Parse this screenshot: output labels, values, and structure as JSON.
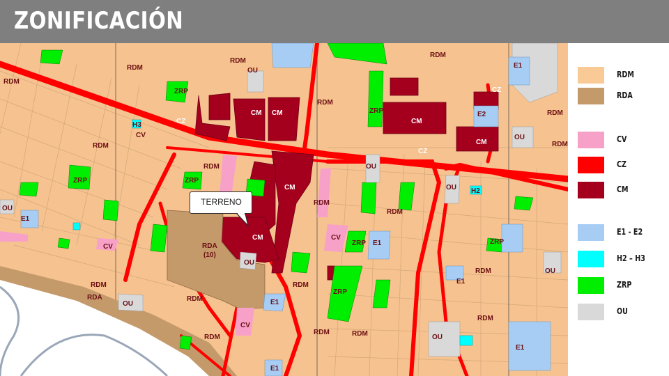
{
  "title": "ZONIFICACIÓN",
  "callout": {
    "label": "TERRENO"
  },
  "legend": [
    {
      "code": "RDM",
      "color": "#f9c996"
    },
    {
      "code": "RDA",
      "color": "#c59a6b"
    },
    {
      "code": "CV",
      "color": "#f7a1c9"
    },
    {
      "code": "CZ",
      "color": "#fe0000"
    },
    {
      "code": "CM",
      "color": "#a4001e"
    },
    {
      "code": "E1 - E2",
      "color": "#a7cdf4"
    },
    {
      "code": "H2 – H3",
      "color": "#00ffff"
    },
    {
      "code": "ZRP",
      "color": "#00ee00"
    },
    {
      "code": "OU",
      "color": "#d9d9d9"
    }
  ],
  "map_labels": {
    "rdm": "RDM",
    "rda": "RDA",
    "rda_site": "RDA",
    "rda_site_num": "(10)",
    "cv": "CV",
    "cz": "CZ",
    "cm": "CM",
    "zrp": "ZRP",
    "ou": "OU",
    "e1": "E1",
    "e2": "E2",
    "h2": "H2",
    "h3": "H3",
    "cv_map": "CV"
  }
}
